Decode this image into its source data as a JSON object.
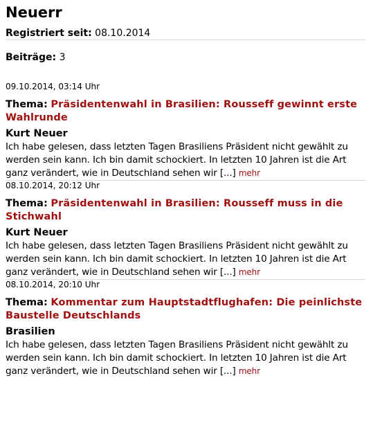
{
  "profile": {
    "username": "Neuerr",
    "registered_label": "Registriert seit:",
    "registered_date": "08.10.2014",
    "posts_label": "Beiträge:",
    "posts_count": "3"
  },
  "posts": [
    {
      "date": "09.10.2014, 03:14 Uhr",
      "topic_label": "Thema:",
      "topic_title": "Präsidentenwahl in Brasilien: Rousseff gewinnt erste Wahlrunde",
      "author": "Kurt Neuer",
      "excerpt": "Ich habe gelesen, dass letzten Tagen Brasiliens Präsident nicht gewählt zu werden sein kann. Ich bin damit schockiert. In letzten 10 Jahren ist die Art ganz verändert, wie in Deutschland sehen wir [...]",
      "more_label": "mehr"
    },
    {
      "date": "08.10.2014, 20:12 Uhr",
      "topic_label": "Thema:",
      "topic_title": "Präsidentenwahl in Brasilien: Rousseff muss in die Stichwahl",
      "author": "Kurt Neuer",
      "excerpt": "Ich habe gelesen, dass letzten Tagen Brasiliens Präsident nicht gewählt zu werden sein kann. Ich bin damit schockiert. In letzten 10 Jahren ist die Art ganz verändert, wie in Deutschland sehen wir [...]",
      "more_label": "mehr"
    },
    {
      "date": "08.10.2014, 20:10 Uhr",
      "topic_label": "Thema:",
      "topic_title": "Kommentar zum Hauptstadtflughafen: Die peinlichste Baustelle Deutschlands",
      "author": "Brasilien",
      "excerpt": "Ich habe gelesen, dass letzten Tagen Brasiliens Präsident nicht gewählt zu werden sein kann. Ich bin damit schockiert. In letzten 10 Jahren ist die Art ganz verändert, wie in Deutschland sehen wir [...]",
      "more_label": "mehr"
    }
  ],
  "colors": {
    "link": "#a01010",
    "separator": "#dcdcdc"
  }
}
